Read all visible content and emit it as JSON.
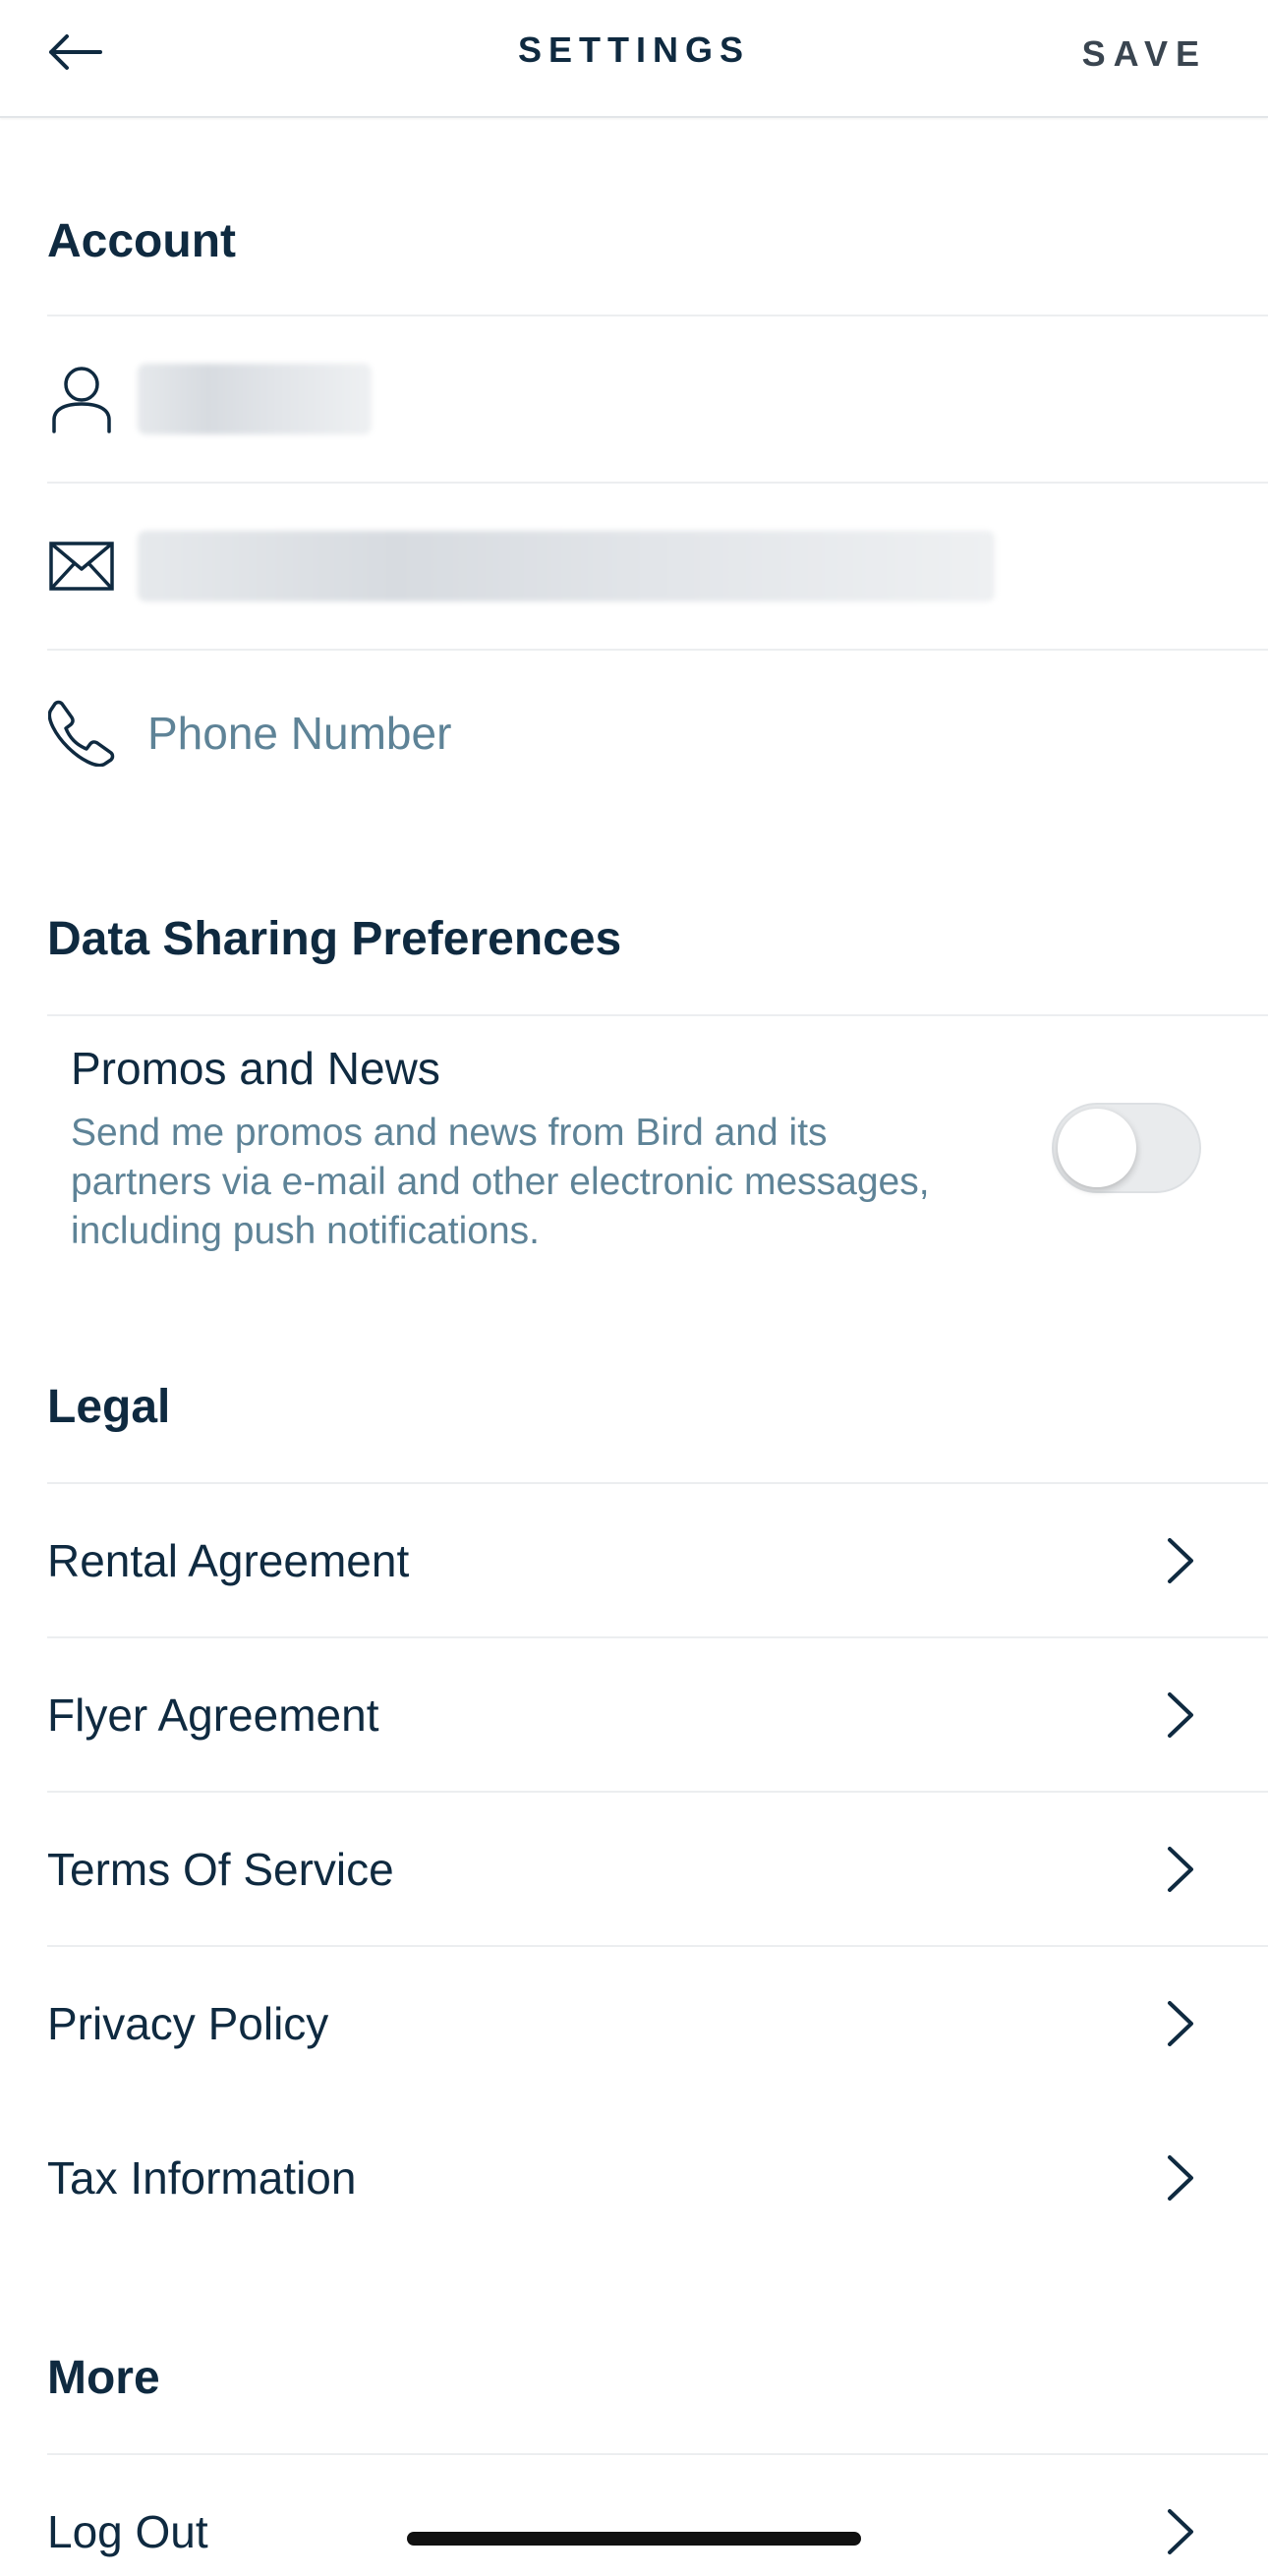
{
  "header": {
    "title": "SETTINGS",
    "save_label": "SAVE"
  },
  "icons": {
    "back": "arrow-left-icon",
    "user": "user-icon",
    "mail": "mail-icon",
    "phone": "phone-icon",
    "chevron": "chevron-right-icon"
  },
  "account": {
    "title": "Account",
    "phone_placeholder": "Phone Number"
  },
  "data_sharing": {
    "title": "Data Sharing Preferences",
    "promos_title": "Promos and News",
    "promos_description": "Send me promos and news from Bird and its partners via e-mail and other electronic messages, including push notifications.",
    "promos_enabled": false
  },
  "legal": {
    "title": "Legal",
    "items": [
      {
        "label": "Rental Agreement"
      },
      {
        "label": "Flyer Agreement"
      },
      {
        "label": "Terms Of Service"
      },
      {
        "label": "Privacy Policy"
      },
      {
        "label": "Tax Information"
      }
    ]
  },
  "more": {
    "title": "More",
    "items": [
      {
        "label": "Log Out"
      }
    ]
  },
  "colors": {
    "text_primary": "#0f2a40",
    "text_secondary": "#5e8397",
    "divider": "#eceef0",
    "toggle_off": "#e9ebed"
  }
}
